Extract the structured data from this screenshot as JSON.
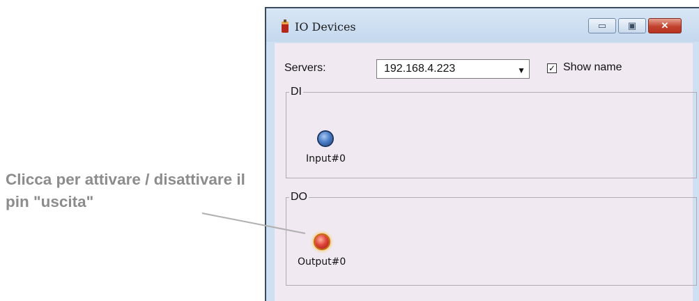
{
  "annotation": {
    "line1": "Clicca per attivare / disattivare il",
    "line2": "pin \"uscita\""
  },
  "window": {
    "title": "IO Devices",
    "controls": {
      "minimize_icon": "minimize-icon",
      "maximize_icon": "maximize-icon",
      "close_icon": "close-icon",
      "minimize_glyph": "▭",
      "maximize_glyph": "▣",
      "close_glyph": "✕"
    }
  },
  "servers": {
    "label": "Servers:",
    "selected": "192.168.4.223",
    "arrow": "▼"
  },
  "show_name": {
    "label": "Show name",
    "checked": true,
    "check_glyph": "✓"
  },
  "di": {
    "legend": "DI",
    "items": [
      {
        "label": "Input#0",
        "state": "off",
        "color": "#4d7fc9"
      }
    ]
  },
  "do": {
    "legend": "DO",
    "items": [
      {
        "label": "Output#0",
        "state": "on",
        "color": "#e0463a"
      }
    ]
  },
  "colors": {
    "annotation_text": "#8c8c8c",
    "window_frame": "#cfe0f2",
    "client_bg": "#f0e9f2",
    "close_button": "#c2432f"
  }
}
